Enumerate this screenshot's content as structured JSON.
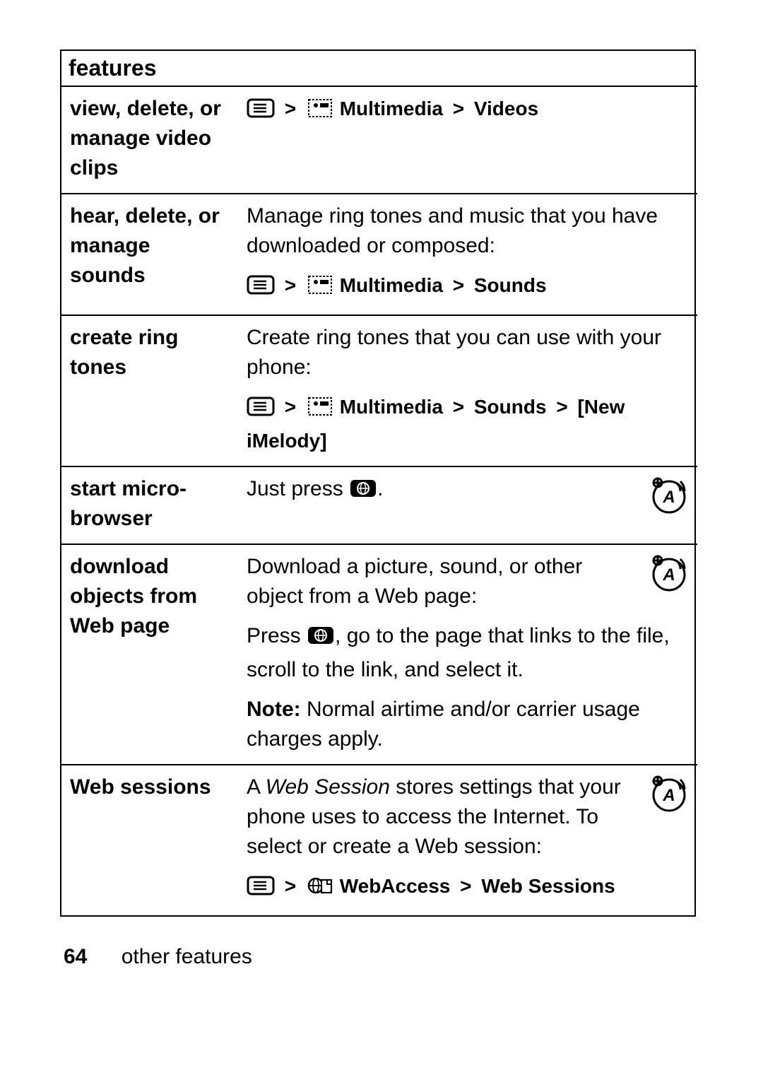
{
  "header": {
    "title": "features"
  },
  "rows": {
    "r1": {
      "feature": "view, delete, or manage video clips",
      "nav_mid": "Multimedia",
      "nav_end": "Videos"
    },
    "r2": {
      "feature": "hear, delete, or manage sounds",
      "body": "Manage ring tones and music that you have downloaded or composed:",
      "nav_mid": "Multimedia",
      "nav_end": "Sounds"
    },
    "r3": {
      "feature": "create ring tones",
      "body": "Create ring tones that you can use with your phone:",
      "nav_mid": "Multimedia",
      "nav_end1": "Sounds",
      "nav_end2": "[New iMelody]"
    },
    "r4": {
      "feature": "start micro-browser",
      "body_pre": "Just press ",
      "body_post": "."
    },
    "r5": {
      "feature": "download objects from Web page",
      "body": "Download a picture, sound, or other object from a Web page:",
      "press_pre": "Press ",
      "press_post": ", go to the page that links to the file, scroll to the link, and select it.",
      "note_label": "Note:",
      "note_body": " Normal airtime and/or carrier usage charges apply."
    },
    "r6": {
      "feature": "Web sessions",
      "body_pre": "A ",
      "body_ital": "Web Session",
      "body_post": " stores settings that your phone uses to access the Internet. To select or create a Web session:",
      "nav_mid": "WebAccess",
      "nav_end": "Web Sessions"
    }
  },
  "footer": {
    "page": "64",
    "section": "other features"
  },
  "gt": ">"
}
